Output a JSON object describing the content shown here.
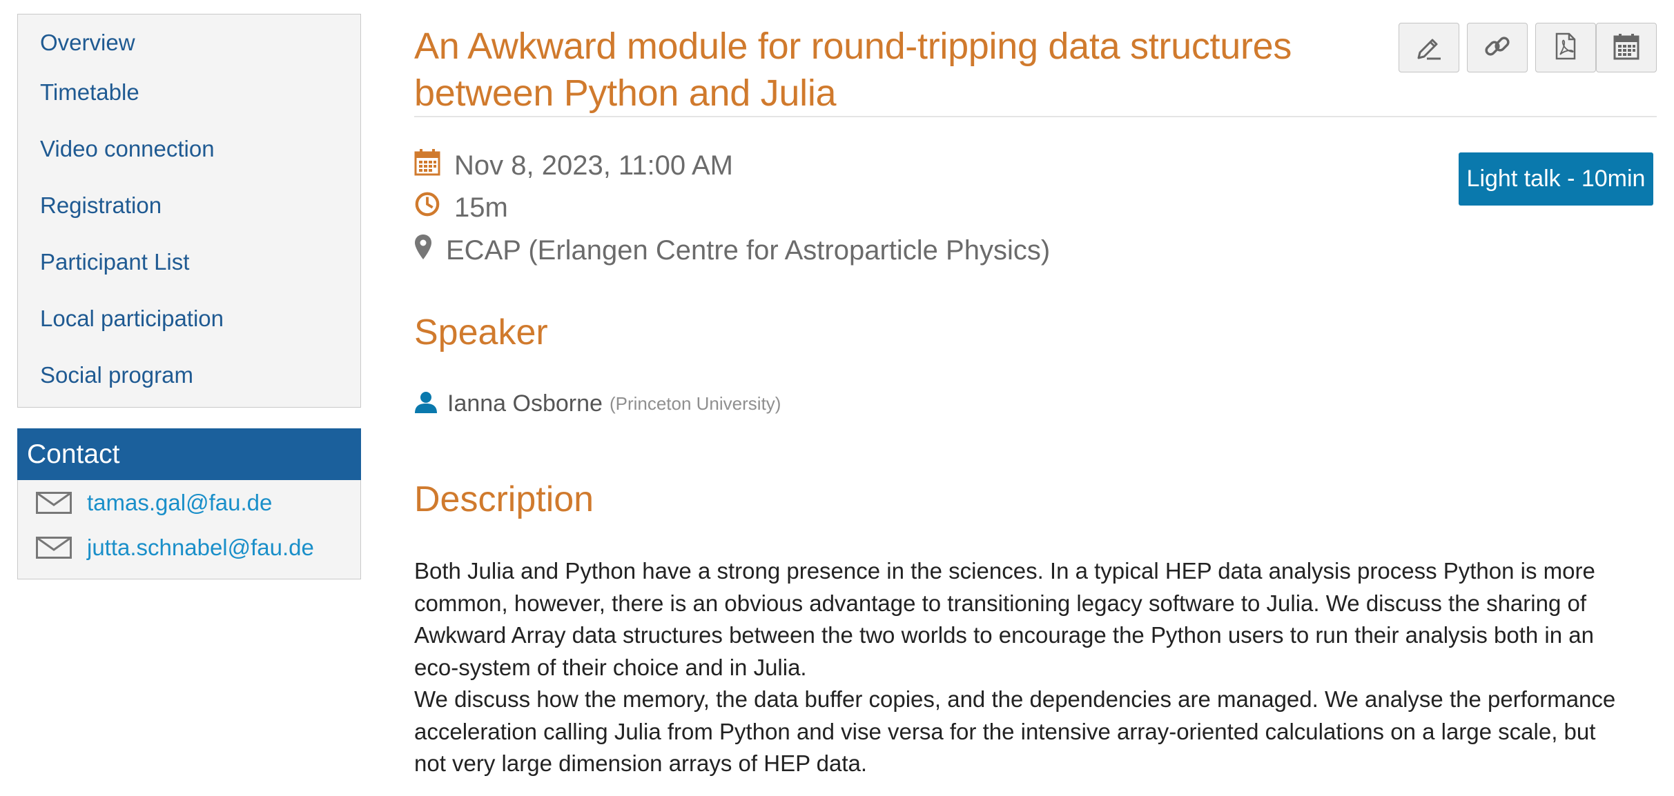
{
  "sidebar": {
    "items": [
      {
        "label": "Overview"
      },
      {
        "label": "Timetable"
      },
      {
        "label": "Video connection"
      },
      {
        "label": "Registration"
      },
      {
        "label": "Participant List"
      },
      {
        "label": "Local participation"
      },
      {
        "label": "Social program"
      }
    ]
  },
  "contact": {
    "header": "Contact",
    "emails": [
      "tamas.gal@fau.de",
      "jutta.schnabel@fau.de"
    ]
  },
  "contribution": {
    "title": "An Awkward module for round-tripping data structures between Python and Julia",
    "date": "Nov 8, 2023, 11:00 AM",
    "duration": "15m",
    "location": "ECAP (Erlangen Centre for Astroparticle Physics)",
    "type_tag": "Light talk - 10min"
  },
  "toolbar": {
    "icons": [
      "pencil-icon",
      "link-icon",
      "pdf-icon",
      "calendar-icon"
    ]
  },
  "speaker": {
    "heading": "Speaker",
    "name": "Ianna Osborne",
    "affiliation": "(Princeton University)"
  },
  "description": {
    "heading": "Description",
    "paragraphs": [
      "Both Julia and Python have a strong presence in the sciences. In a typical HEP data analysis process Python is more common, however, there is an obvious advantage to transitioning legacy software to Julia. We discuss the sharing of Awkward Array data structures between the two worlds to encourage the Python users to run their analysis both in an eco-system of their choice and in Julia.",
      "We discuss how the memory, the data buffer copies, and the dependencies are managed. We analyse the performance acceleration calling Julia from Python and vise versa for the intensive array-oriented calculations on a large scale, but not very large dimension arrays of HEP data."
    ]
  },
  "colors": {
    "accent_orange": "#d07a2d",
    "link_blue": "#1f5a92",
    "contact_header": "#1b609c",
    "tag_blue": "#0a79ad"
  }
}
